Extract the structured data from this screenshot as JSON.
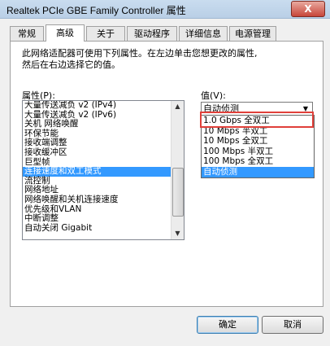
{
  "window": {
    "title": "Realtek PCIe GBE Family Controller 属性",
    "close_label": "X"
  },
  "tabs": [
    {
      "label": "常规"
    },
    {
      "label": "高级"
    },
    {
      "label": "关于"
    },
    {
      "label": "驱动程序"
    },
    {
      "label": "详细信息"
    },
    {
      "label": "电源管理"
    }
  ],
  "active_tab": "高级",
  "panel": {
    "description_line1": "此网络适配器可使用下列属性。在左边单击您想更改的属性,",
    "description_line2": "然后在右边选择它的值。",
    "property_label": "属性(P):",
    "value_label": "值(V):",
    "properties": [
      "大量传送减负 v2 (IPv4)",
      "大量传送减负 v2 (IPv6)",
      "关机 网络唤醒",
      "环保节能",
      "接收端调整",
      "接收缓冲区",
      "巨型帧",
      "连接速度和双工模式",
      "流控制",
      "网络地址",
      "网络唤醒和关机连接速度",
      "优先级和VLAN",
      "中断调整",
      "自动关闭 Gigabit"
    ],
    "selected_property": "连接速度和双工模式",
    "combo_value": "自动侦测",
    "dropdown_options": [
      "1.0 Gbps 全双工",
      "10 Mbps 半双工",
      "10 Mbps 全双工",
      "100 Mbps 半双工",
      "100 Mbps 全双工",
      "自动侦测"
    ],
    "selected_option": "自动侦测",
    "highlighted_option": "1.0 Gbps 全双工"
  },
  "buttons": {
    "ok": "确定",
    "cancel": "取消"
  },
  "colors": {
    "selection": "#3399ff",
    "annotation": "#e0403a"
  }
}
